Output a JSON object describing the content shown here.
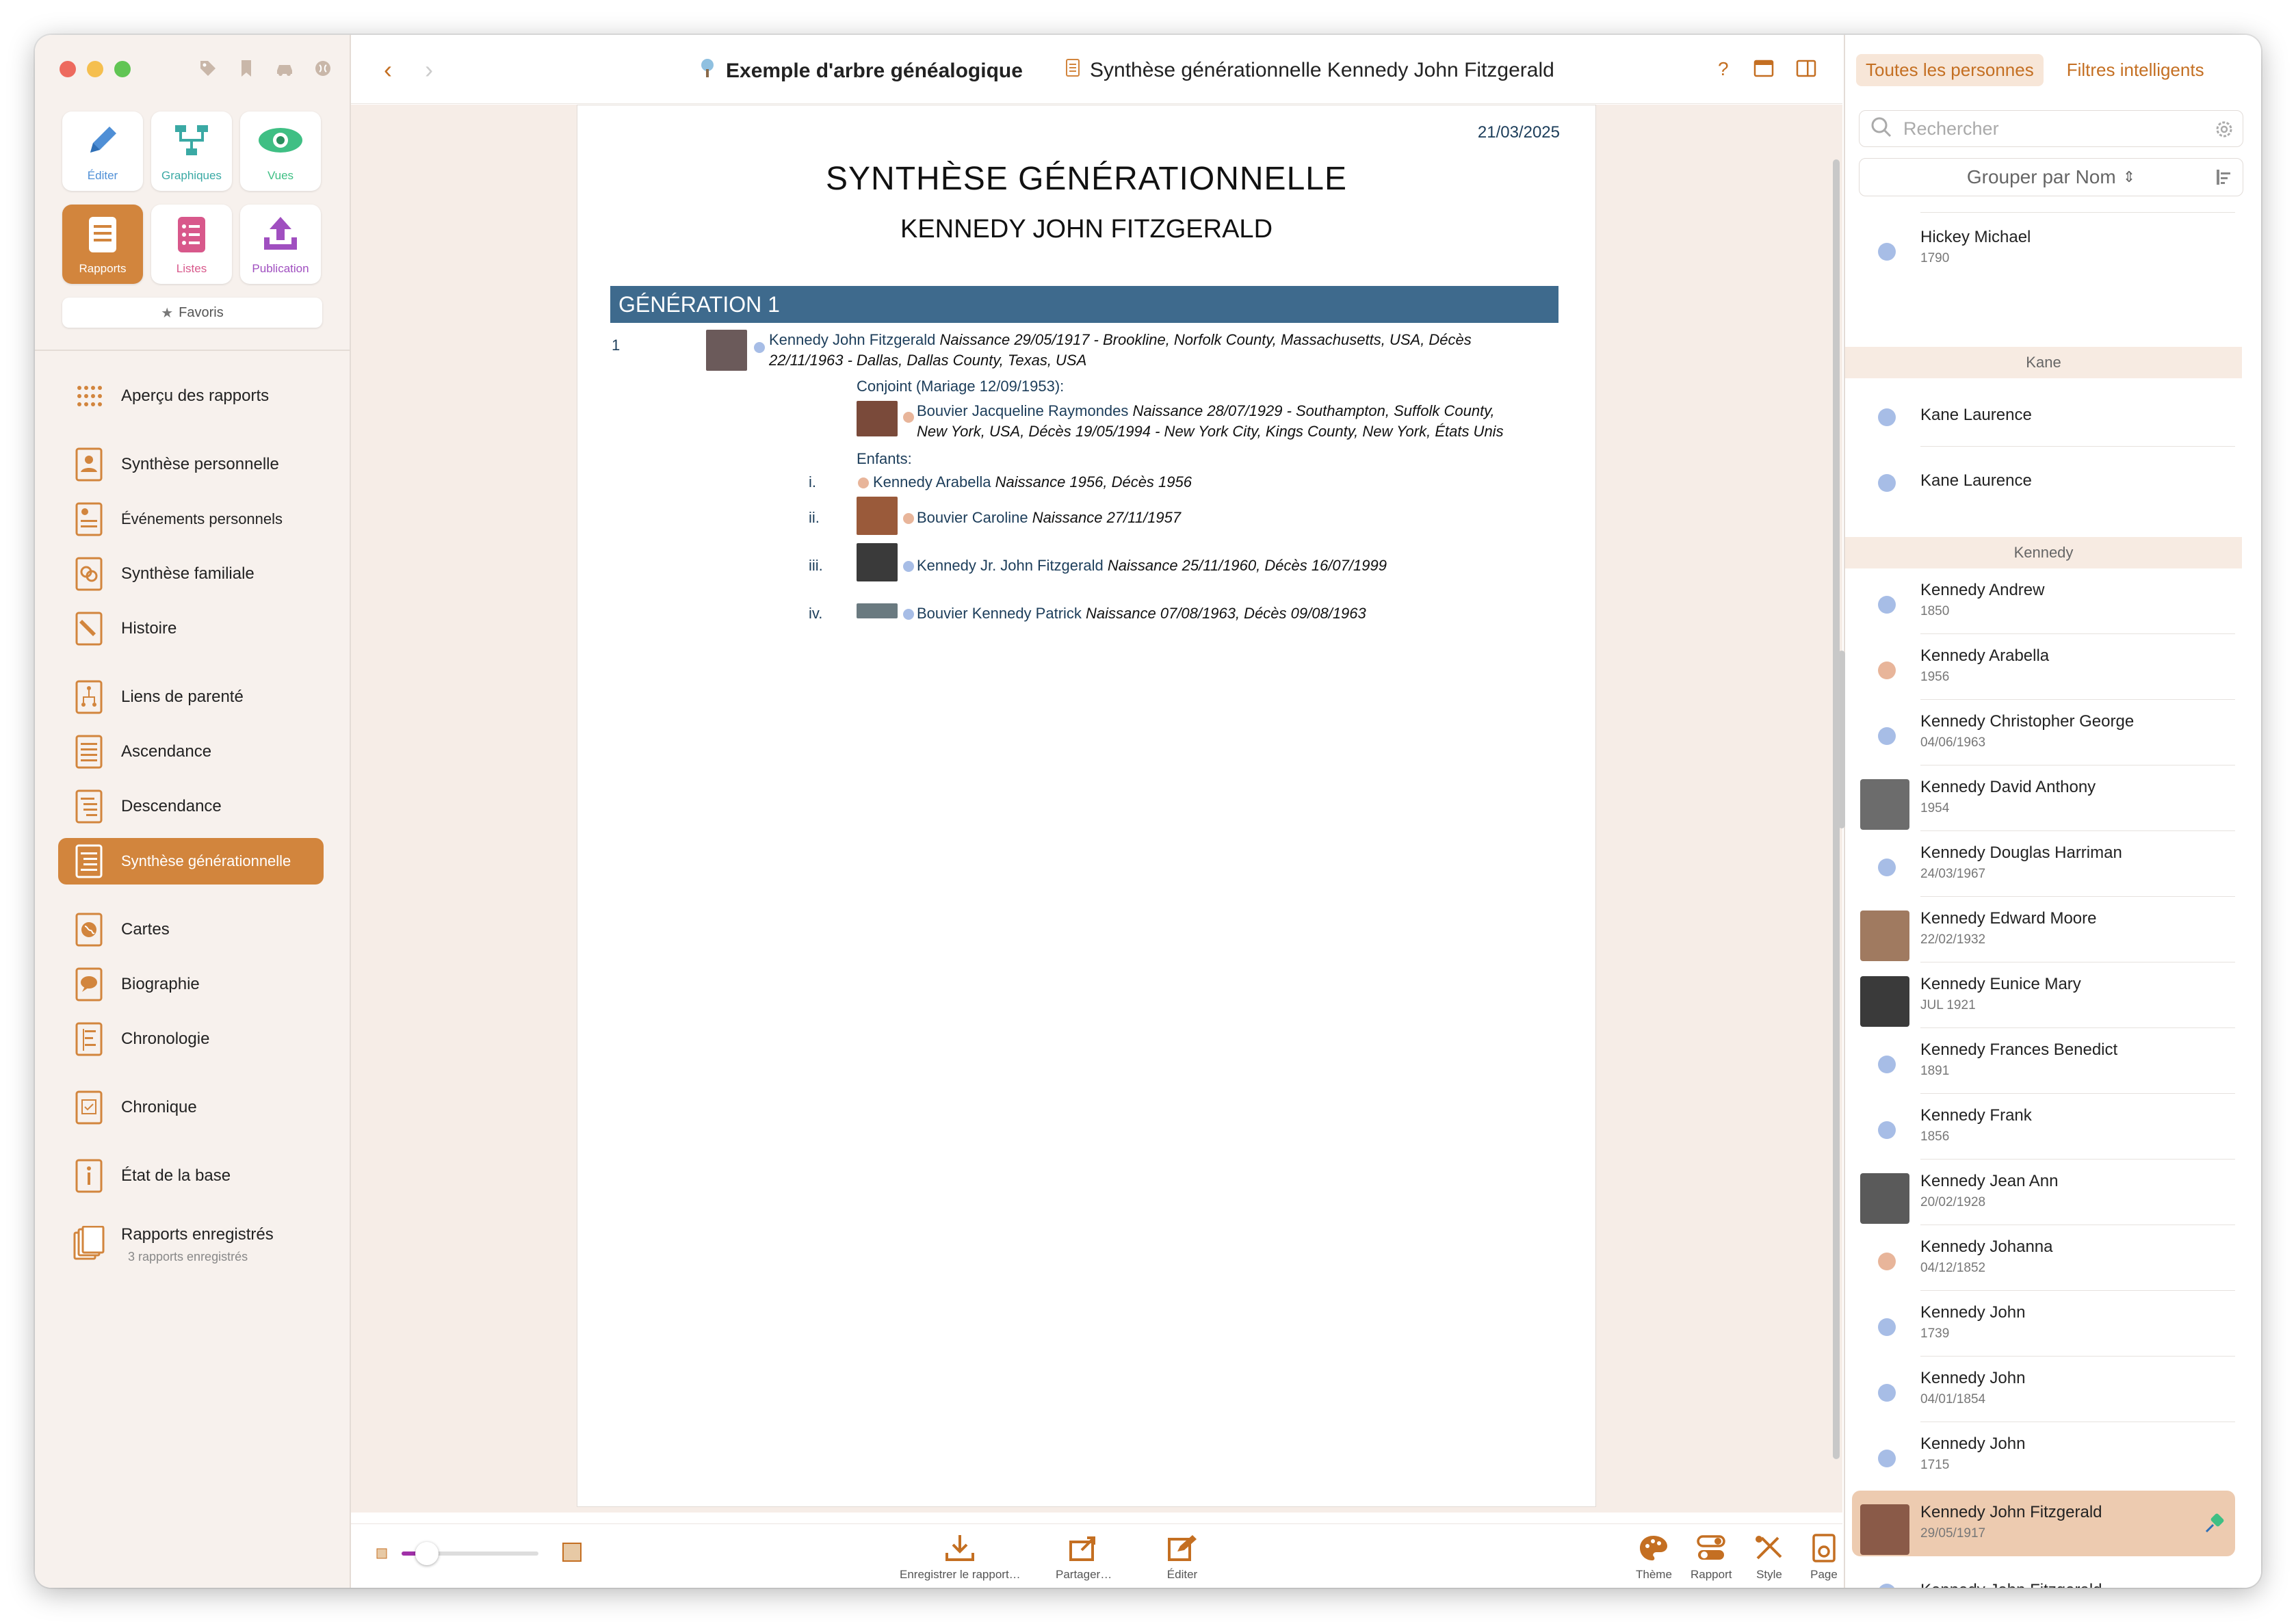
{
  "toolbar": {
    "tree_name": "Exemple d'arbre généalogique",
    "report_name": "Synthèse générationnelle Kennedy John Fitzgerald",
    "help": "?"
  },
  "sidebar": {
    "tiles": [
      {
        "label": "Éditer",
        "icon": "pencil-icon"
      },
      {
        "label": "Graphiques",
        "icon": "chart-tree-icon"
      },
      {
        "label": "Vues",
        "icon": "eye-icon"
      },
      {
        "label": "Rapports",
        "icon": "report-icon"
      },
      {
        "label": "Listes",
        "icon": "list-icon"
      },
      {
        "label": "Publication",
        "icon": "upload-icon"
      }
    ],
    "favorites": "Favoris",
    "items": [
      {
        "label": "Aperçu des rapports",
        "icon": "grid-icon"
      },
      {
        "label": "Synthèse personnelle",
        "icon": "person-card-icon"
      },
      {
        "label": "Événements personnels",
        "icon": "person-events-icon"
      },
      {
        "label": "Synthèse familiale",
        "icon": "family-icon"
      },
      {
        "label": "Histoire",
        "icon": "pencil-doc-icon"
      },
      {
        "label": "Liens de parenté",
        "icon": "relationship-icon"
      },
      {
        "label": "Ascendance",
        "icon": "ancestry-icon"
      },
      {
        "label": "Descendance",
        "icon": "descendancy-icon"
      },
      {
        "label": "Synthèse générationnelle",
        "icon": "generation-icon"
      },
      {
        "label": "Cartes",
        "icon": "map-icon"
      },
      {
        "label": "Biographie",
        "icon": "biography-icon"
      },
      {
        "label": "Chronologie",
        "icon": "timeline-icon"
      },
      {
        "label": "Chronique",
        "icon": "chronicle-icon"
      },
      {
        "label": "État de la base",
        "icon": "info-icon"
      },
      {
        "label": "Rapports enregistrés",
        "icon": "saved-reports-icon"
      }
    ],
    "saved_reports_sub": "3 rapports enregistrés"
  },
  "report": {
    "date": "21/03/2025",
    "title": "SYNTHÈSE GÉNÉRATIONNELLE",
    "subtitle": "KENNEDY JOHN FITZGERALD",
    "generation_header": "GÉNÉRATION 1",
    "number": "1",
    "main_person_link": "Kennedy John Fitzgerald",
    "main_person_line1": " Naissance 29/05/1917 - Brookline, Norfolk County, Massachusetts, USA, Décès",
    "main_person_line2": "22/11/1963 - Dallas, Dallas County, Texas, USA",
    "spouse_header": "Conjoint (Mariage 12/09/1953):",
    "spouse_link": "Bouvier Jacqueline Raymondes",
    "spouse_line1": " Naissance 28/07/1929 - Southampton, Suffolk County,",
    "spouse_line2": "New York, USA, Décès 19/05/1994 - New York City, Kings County, New York, États Unis",
    "children_header": "Enfants:",
    "children": [
      {
        "num": "i.",
        "link": "Kennedy Arabella",
        "text": " Naissance 1956, Décès 1956"
      },
      {
        "num": "ii.",
        "link": "Bouvier Caroline",
        "text": " Naissance 27/11/1957"
      },
      {
        "num": "iii.",
        "link": "Kennedy Jr. John Fitzgerald",
        "text": " Naissance 25/11/1960, Décès 16/07/1999"
      },
      {
        "num": "iv.",
        "link": "Bouvier Kennedy Patrick",
        "text": " Naissance 07/08/1963, Décès 09/08/1963"
      }
    ]
  },
  "bottombar": {
    "save": "Enregistrer le rapport…",
    "share": "Partager…",
    "edit": "Éditer",
    "theme": "Thème",
    "report": "Rapport",
    "style": "Style",
    "page": "Page"
  },
  "rightpanel": {
    "tab_all": "Toutes les personnes",
    "tab_smart": "Filtres intelligents",
    "search_placeholder": "Rechercher",
    "group_by": "Grouper par Nom",
    "rows_top": [
      {
        "name": "Hickey Michael",
        "date": "1790",
        "gender": "m"
      }
    ],
    "section_kane": "Kane",
    "rows_kane": [
      {
        "name": "Kane Laurence",
        "date": "",
        "gender": "m"
      },
      {
        "name": "Kane Laurence",
        "date": "",
        "gender": "m"
      }
    ],
    "section_kennedy": "Kennedy",
    "rows_kennedy": [
      {
        "name": "Kennedy Andrew",
        "date": "1850",
        "gender": "m",
        "photo": false
      },
      {
        "name": "Kennedy Arabella",
        "date": "1956",
        "gender": "f",
        "photo": false
      },
      {
        "name": "Kennedy Christopher George",
        "date": "04/06/1963",
        "gender": "m",
        "photo": false
      },
      {
        "name": "Kennedy David Anthony",
        "date": "1954",
        "gender": "m",
        "photo": true
      },
      {
        "name": "Kennedy Douglas Harriman",
        "date": "24/03/1967",
        "gender": "m",
        "photo": false
      },
      {
        "name": "Kennedy Edward Moore",
        "date": "22/02/1932",
        "gender": "m",
        "photo": true
      },
      {
        "name": "Kennedy Eunice Mary",
        "date": "JUL 1921",
        "gender": "f",
        "photo": true
      },
      {
        "name": "Kennedy Frances Benedict",
        "date": "1891",
        "gender": "m",
        "photo": false
      },
      {
        "name": "Kennedy Frank",
        "date": "1856",
        "gender": "m",
        "photo": false
      },
      {
        "name": "Kennedy Jean Ann",
        "date": "20/02/1928",
        "gender": "f",
        "photo": true
      },
      {
        "name": "Kennedy Johanna",
        "date": "04/12/1852",
        "gender": "f",
        "photo": false
      },
      {
        "name": "Kennedy John",
        "date": "1739",
        "gender": "m",
        "photo": false
      },
      {
        "name": "Kennedy John",
        "date": "04/01/1854",
        "gender": "m",
        "photo": false
      },
      {
        "name": "Kennedy John",
        "date": "1715",
        "gender": "m",
        "photo": false
      },
      {
        "name": "Kennedy John Fitzgerald",
        "date": "29/05/1917",
        "gender": "m",
        "photo": true,
        "selected": true
      },
      {
        "name": "Kennedy John Fitzgerald",
        "date": "",
        "gender": "m",
        "photo": false
      }
    ]
  },
  "colors": {
    "accent": "#d2853d",
    "link": "#1c3d5a",
    "generation_bar": "#3e6a8d",
    "selected_row": "#edcbb0",
    "male": "#a7bde6",
    "female": "#e8b59a"
  }
}
